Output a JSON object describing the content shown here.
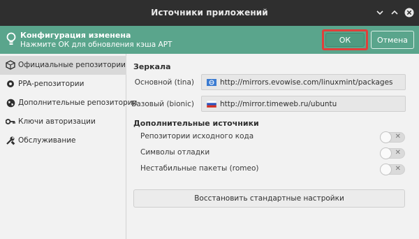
{
  "window": {
    "title": "Источники приложений",
    "buttons": [
      "minimize",
      "maximize",
      "close"
    ]
  },
  "infobar": {
    "title": "Конфигурация изменена",
    "subtitle": "Нажмите ОК для обновления кэша APT",
    "ok_label": "ОК",
    "cancel_label": "Отмена"
  },
  "sidebar": {
    "items": [
      {
        "label": "Официальные репозитории",
        "icon": "package-icon",
        "selected": true
      },
      {
        "label": "PPA-репозитории",
        "icon": "ppa-icon",
        "selected": false
      },
      {
        "label": "Дополнительные репозитории",
        "icon": "globe-icon",
        "selected": false
      },
      {
        "label": "Ключи авторизации",
        "icon": "key-icon",
        "selected": false
      },
      {
        "label": "Обслуживание",
        "icon": "tools-icon",
        "selected": false
      }
    ]
  },
  "mirrors": {
    "heading": "Зеркала",
    "main_label": "Основной (tina)",
    "main_url": "http://mirrors.evowise.com/linuxmint/packages",
    "base_label": "Базовый (bionic)",
    "base_url": "http://mirror.timeweb.ru/ubuntu"
  },
  "sources": {
    "heading": "Дополнительные источники",
    "options": [
      {
        "label": "Репозитории исходного кода",
        "enabled": false
      },
      {
        "label": "Символы отладки",
        "enabled": false
      },
      {
        "label": "Нестабильные пакеты (romeo)",
        "enabled": false
      }
    ]
  },
  "restore_label": "Восстановить стандартные настройки",
  "colors": {
    "titlebar": "#2f2f2f",
    "infobar": "#5aa58c",
    "ok_button": "#4f9b81",
    "highlight": "#e0403b",
    "sidebar_selected": "#d9d9d9"
  }
}
